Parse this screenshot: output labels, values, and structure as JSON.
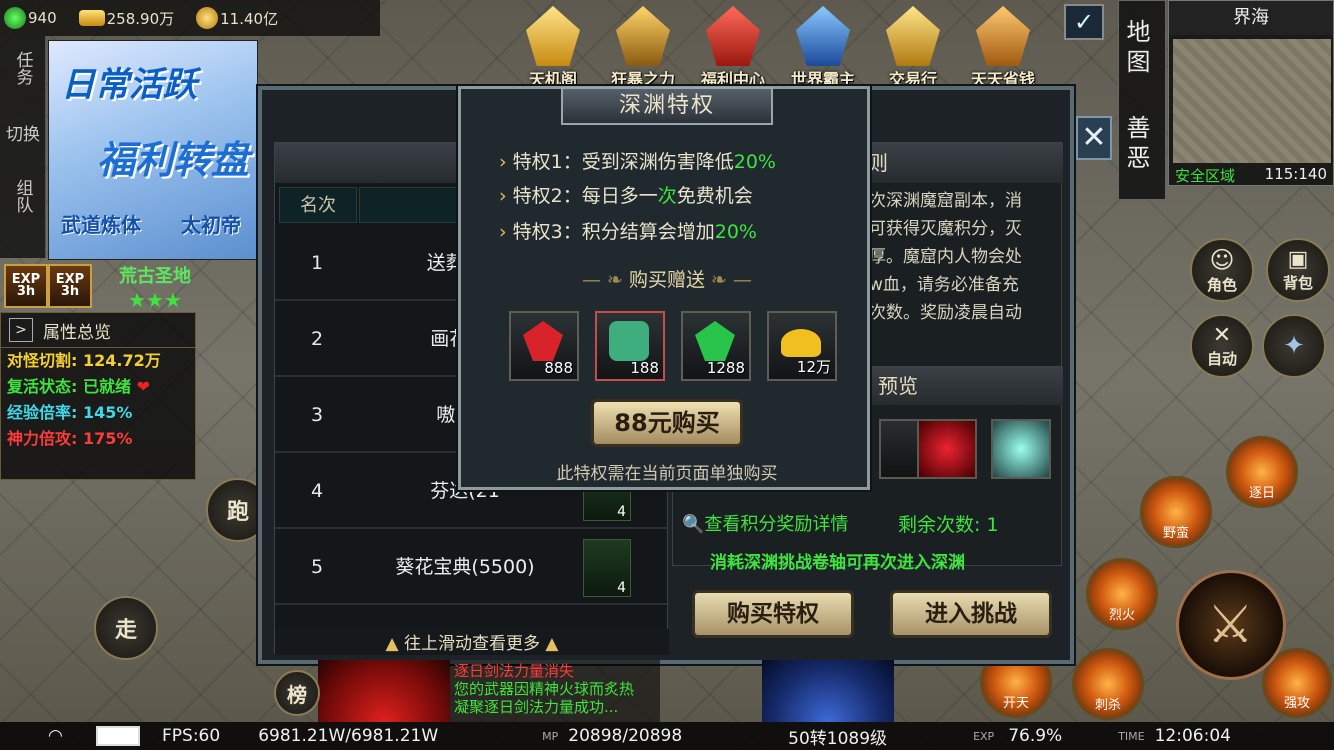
{
  "resources": {
    "jade": "940",
    "gold_ingot": "258.90万",
    "coin": "11.40亿"
  },
  "left_menu": {
    "task": "任务",
    "switch": "切换",
    "team": "组队"
  },
  "banner": {
    "line1": "日常活跃",
    "line2": "福利转盘",
    "tag1": "武道炼体",
    "tag2": "太初帝"
  },
  "buffs": [
    {
      "label": "EXP",
      "count": "1",
      "time": "3h"
    },
    {
      "label": "EXP",
      "count": "1",
      "time": "3h"
    }
  ],
  "zone_badge": {
    "name": "荒古圣地",
    "stars": "★★★"
  },
  "attr": {
    "title": "属性总览",
    "rows": [
      {
        "label": "对怪切割:",
        "value": "124.72万"
      },
      {
        "label": "复活状态:",
        "value": "已就绪"
      },
      {
        "label": "经验倍率:",
        "value": "145%"
      },
      {
        "label": "神力倍攻:",
        "value": "175%"
      }
    ]
  },
  "top_icons": [
    "天机阁",
    "狂暴之力",
    "福利中心",
    "世界霸主",
    "交易行",
    "天天省钱"
  ],
  "map": {
    "nav_map": "地图",
    "nav_karma": "善恶",
    "zone": "界海",
    "safe": "安全区域",
    "coord": "115:140"
  },
  "right_buttons": {
    "role": "角色",
    "bag": "背包",
    "auto": "自动",
    "run": "跑",
    "walk": "走"
  },
  "skills": [
    "逐日",
    "野蛮",
    "烈火",
    "开天",
    "刺杀",
    "强攻"
  ],
  "dialog": {
    "rank_tab": "灭",
    "rules_tab": "规则",
    "col_rank": "名次",
    "col_score": "积",
    "rows": [
      {
        "rank": "1",
        "name": "送葬者(5",
        "reward": ""
      },
      {
        "rank": "2",
        "name": "画花(34",
        "reward": ""
      },
      {
        "rank": "3",
        "name": "嗷呜(2",
        "reward": ""
      },
      {
        "rank": "4",
        "name": "芬达(21",
        "reward": "4"
      },
      {
        "rank": "5",
        "name": "葵花宝典(5500)",
        "reward": "4"
      }
    ],
    "scroll_hint": "往上滑动查看更多",
    "rules_lines": [
      "次深渊魔窟副本，消",
      "可获得灭魔积分，灭",
      "厚。魔窟内人物会处",
      "w血，请务必准备充",
      "次数。奖励凌晨自动"
    ],
    "preview_tab": "预览",
    "detail_link": "查看积分奖励详情",
    "remain": "剩余次数: 1",
    "consume": "消耗深渊挑战卷轴可再次进入深渊",
    "buy_priv": "购买特权",
    "enter": "进入挑战"
  },
  "popup": {
    "title": "深渊特权",
    "privs": [
      {
        "text": "特权1：受到深渊伤害降低",
        "pct": "20%"
      },
      {
        "text": "特权2：每日多一",
        "hl": "次",
        "text2": "免费机会"
      },
      {
        "text": "特权3：积分结算会增加",
        "pct": "20%"
      }
    ],
    "gift_title": "购买赠送",
    "gifts": [
      {
        "qty": "888",
        "color": "#d8232a"
      },
      {
        "qty": "188",
        "color": "#3fae7f"
      },
      {
        "qty": "1288",
        "color": "#29c44a"
      },
      {
        "qty": "12万",
        "color": "#f0c020"
      }
    ],
    "buy": "88元购买",
    "note": "此特权需在当前页面单独购买"
  },
  "chat": {
    "line1": "逐日剑法力量消失",
    "line2": "您的武器因精神火球而炙热",
    "line3": "凝聚逐日剑法力量成功..."
  },
  "status": {
    "fps": "FPS:60",
    "hp": "6981.21W/6981.21W",
    "mp_label": "MP",
    "mp": "20898/20898",
    "level": "50转1089级",
    "exp_label": "EXP",
    "exp": "76.9%",
    "time_label": "TIME",
    "time": "12:06:04",
    "rank_btn": "榜"
  }
}
